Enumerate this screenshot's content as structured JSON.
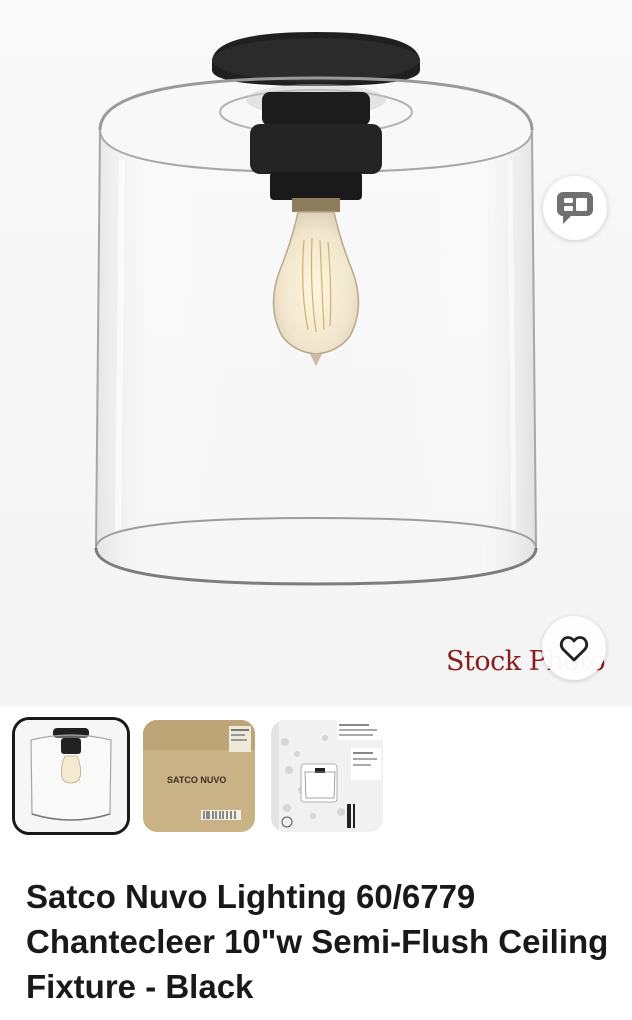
{
  "gallery": {
    "stock_label": "Stock Photo",
    "compare_icon": "compare-chat-icon",
    "watch_icon": "heart-icon",
    "thumbnails": [
      {
        "name": "product-photo",
        "selected": true
      },
      {
        "name": "box-front",
        "brand_text": "SATCO NUVO",
        "selected": false
      },
      {
        "name": "box-label",
        "selected": false
      }
    ]
  },
  "listing": {
    "title": "Satco Nuvo Lighting 60/6779 Chantecleer 10\"w Semi-Flush Ceiling Fixture - Black"
  },
  "colors": {
    "title_text": "#191919",
    "stock_label": "#8a1c1c",
    "selected_border": "#191919"
  }
}
